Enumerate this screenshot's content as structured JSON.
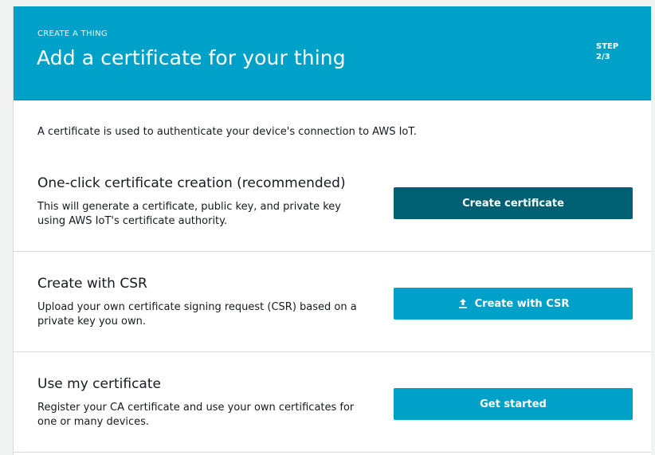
{
  "header": {
    "eyebrow": "CREATE A THING",
    "title": "Add a certificate for your thing",
    "step_label": "STEP",
    "step_value": "2/3"
  },
  "intro": "A certificate is used to authenticate your device's connection to AWS IoT.",
  "options": [
    {
      "title": "One-click certificate creation (recommended)",
      "description": "This will generate a certificate, public key, and private key using AWS IoT's certificate authority.",
      "button_label": "Create certificate"
    },
    {
      "title": "Create with CSR",
      "description": "Upload your own certificate signing request (CSR) based on a private key you own.",
      "button_label": "Create with CSR",
      "button_icon": "upload-icon"
    },
    {
      "title": "Use my certificate",
      "description": "Register your CA certificate and use your own certificates for one or many devices.",
      "button_label": "Get started"
    }
  ],
  "colors": {
    "header_bg": "#00a1c9",
    "primary_button": "#006073",
    "secondary_button": "#00a1c9"
  }
}
